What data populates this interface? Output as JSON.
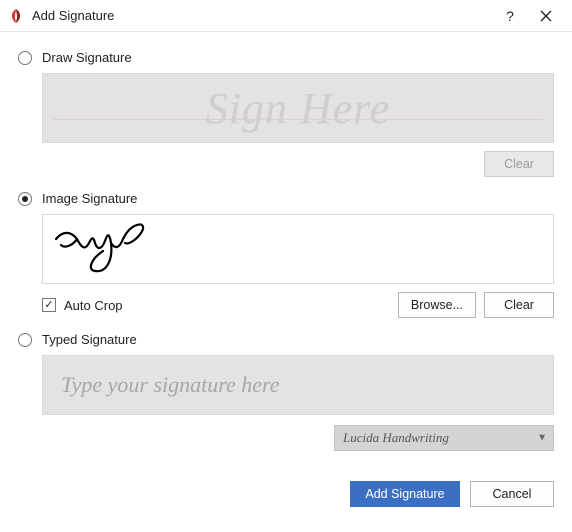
{
  "window": {
    "title": "Add Signature"
  },
  "options": {
    "draw": {
      "label": "Draw Signature",
      "selected": false
    },
    "image": {
      "label": "Image Signature",
      "selected": true
    },
    "typed": {
      "label": "Typed Signature",
      "selected": false
    }
  },
  "draw": {
    "placeholder": "Sign Here",
    "clear_label": "Clear"
  },
  "image": {
    "auto_crop_label": "Auto Crop",
    "auto_crop_checked": true,
    "browse_label": "Browse...",
    "clear_label": "Clear"
  },
  "typed": {
    "placeholder": "Type your signature here",
    "font_selected": "Lucida Handwriting"
  },
  "footer": {
    "primary_label": "Add Signature",
    "cancel_label": "Cancel"
  }
}
